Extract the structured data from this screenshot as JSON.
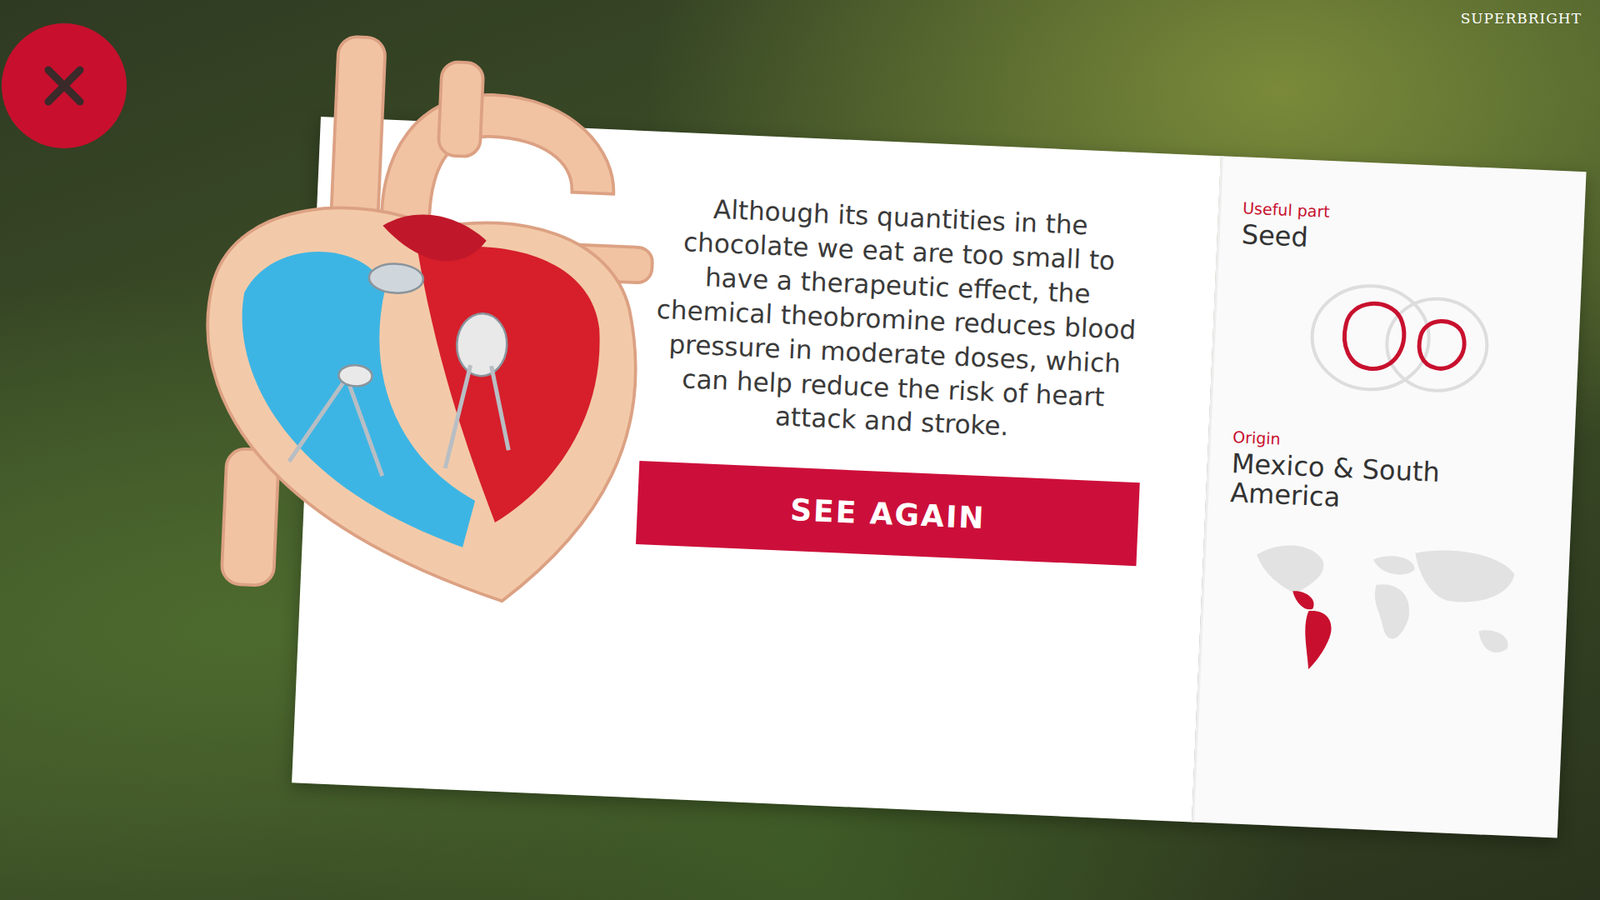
{
  "watermark": "SUPERBRIGHT",
  "card": {
    "description": "Although its quantities in the chocolate we eat are too small to have a therapeutic effect, the chemical theobromine reduces blood pressure in moderate doses, which can help reduce the risk of heart attack and stroke.",
    "button": "SEE AGAIN"
  },
  "details": [
    {
      "label": "Useful part",
      "value": "Seed",
      "kind": "seed"
    },
    {
      "label": "Origin",
      "value": "Mexico & South America",
      "kind": "map"
    }
  ]
}
